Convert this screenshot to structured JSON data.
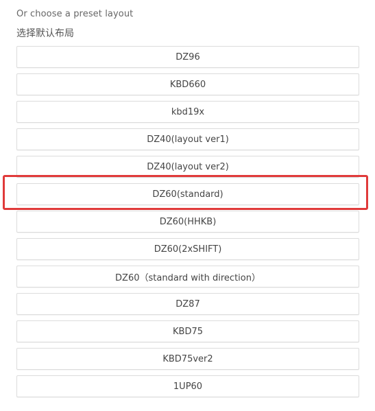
{
  "heading": "Or choose a preset layout",
  "subheading": "选择默认布局",
  "presets": [
    {
      "label": "DZ96"
    },
    {
      "label": "KBD660"
    },
    {
      "label": "kbd19x"
    },
    {
      "label": "DZ40(layout ver1)"
    },
    {
      "label": "DZ40(layout ver2)"
    },
    {
      "label": "DZ60(standard)",
      "highlighted": true
    },
    {
      "label": "DZ60(HHKB)"
    },
    {
      "label": "DZ60(2xSHIFT)"
    },
    {
      "label": "DZ60（standard with direction）"
    },
    {
      "label": "DZ87"
    },
    {
      "label": "KBD75"
    },
    {
      "label": "KBD75ver2"
    },
    {
      "label": "1UP60"
    }
  ],
  "colors": {
    "highlight": "#e03a3a",
    "button_border": "#dcdcdc"
  }
}
